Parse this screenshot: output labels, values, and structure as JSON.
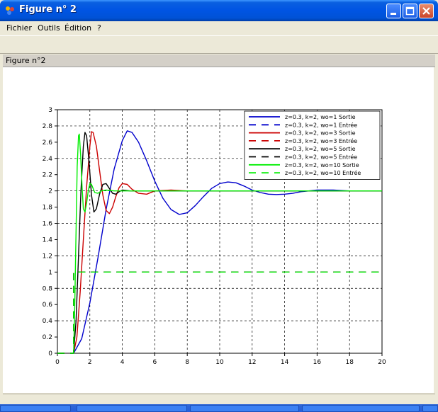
{
  "window": {
    "title": "Figure n° 2"
  },
  "menu": [
    "Fichier",
    "Outils",
    "Édition",
    "?"
  ],
  "figure_label": "Figure n°2",
  "colors": {
    "blue": "#0000cc",
    "red": "#cc0000",
    "black": "#000000",
    "green": "#00ee00"
  },
  "chart_data": {
    "type": "line",
    "title": "",
    "xlabel": "",
    "ylabel": "",
    "xlim": [
      0,
      20
    ],
    "ylim": [
      0,
      3
    ],
    "xticks": [
      0,
      2,
      4,
      6,
      8,
      10,
      12,
      14,
      16,
      18,
      20
    ],
    "yticks": [
      0,
      0.2,
      0.4,
      0.6,
      0.8,
      1,
      1.2,
      1.4,
      1.6,
      1.8,
      2,
      2.2,
      2.4,
      2.6,
      2.8,
      3
    ],
    "grid": true,
    "legend_position": "top-right",
    "series": [
      {
        "name": "z=0.3, k=2, wo=1 Sortie",
        "color": "#0000cc",
        "style": "solid",
        "x": [
          1,
          1.5,
          2,
          2.5,
          3,
          3.5,
          4,
          4.3,
          4.6,
          5,
          5.5,
          6,
          6.5,
          7,
          7.5,
          8,
          8.5,
          9,
          9.5,
          10,
          10.5,
          11,
          11.5,
          12,
          12.5,
          13,
          13.5,
          14,
          14.5,
          15,
          16,
          17,
          18,
          19,
          20
        ],
        "y": [
          0,
          0.18,
          0.62,
          1.18,
          1.77,
          2.27,
          2.62,
          2.74,
          2.72,
          2.6,
          2.37,
          2.12,
          1.91,
          1.77,
          1.71,
          1.73,
          1.82,
          1.93,
          2.03,
          2.09,
          2.11,
          2.1,
          2.06,
          2.01,
          1.98,
          1.96,
          1.955,
          1.96,
          1.97,
          1.99,
          2.01,
          2.01,
          2.0,
          2.0,
          2.0
        ]
      },
      {
        "name": "z=0.3, k=2, wo=1 Entrée",
        "color": "#0000cc",
        "style": "dashed",
        "x": [
          0,
          1,
          1,
          20
        ],
        "y": [
          0,
          0,
          1,
          1
        ]
      },
      {
        "name": "z=0.3, k=2, wo=3 Sortie",
        "color": "#cc0000",
        "style": "solid",
        "x": [
          1,
          1.2,
          1.4,
          1.6,
          1.8,
          2,
          2.1,
          2.2,
          2.4,
          2.6,
          2.8,
          3,
          3.2,
          3.4,
          3.6,
          3.8,
          4,
          4.3,
          4.6,
          5,
          5.5,
          6,
          7,
          8,
          9,
          10,
          20
        ],
        "y": [
          0,
          0.2,
          0.75,
          1.4,
          2.05,
          2.55,
          2.73,
          2.72,
          2.55,
          2.25,
          1.95,
          1.76,
          1.72,
          1.8,
          1.93,
          2.04,
          2.09,
          2.08,
          2.02,
          1.97,
          1.96,
          2.0,
          2.01,
          2.0,
          2.0,
          2.0,
          2.0
        ]
      },
      {
        "name": "z=0.3, k=2, wo=3 Entrée",
        "color": "#cc0000",
        "style": "dashed",
        "x": [
          0,
          1,
          1,
          20
        ],
        "y": [
          0,
          0,
          1,
          1
        ]
      },
      {
        "name": "z=0.3, k=2, wo=5 Sortie",
        "color": "#000000",
        "style": "solid",
        "x": [
          1,
          1.15,
          1.3,
          1.45,
          1.6,
          1.7,
          1.8,
          1.95,
          2.1,
          2.25,
          2.4,
          2.6,
          2.8,
          3,
          3.2,
          3.4,
          3.6,
          3.8,
          4,
          4.5,
          5,
          6,
          8,
          10,
          20
        ],
        "y": [
          0,
          0.4,
          1.2,
          2.0,
          2.55,
          2.72,
          2.68,
          2.35,
          1.95,
          1.74,
          1.78,
          1.96,
          2.08,
          2.09,
          2.03,
          1.97,
          1.96,
          1.99,
          2.01,
          2.0,
          2.0,
          2.0,
          2.0,
          2.0,
          2.0
        ]
      },
      {
        "name": "z=0.3, k=2, wo=5 Entrée",
        "color": "#000000",
        "style": "dashed",
        "x": [
          0,
          1,
          1,
          20
        ],
        "y": [
          0,
          0,
          1,
          1
        ]
      },
      {
        "name": "z=0.3, k=2, wo=10 Sortie",
        "color": "#00ee00",
        "style": "solid",
        "x": [
          1,
          1.07,
          1.15,
          1.22,
          1.3,
          1.35,
          1.43,
          1.52,
          1.6,
          1.7,
          1.8,
          1.9,
          2,
          2.1,
          2.2,
          2.3,
          2.5,
          2.7,
          3,
          3.5,
          4,
          5,
          6,
          10,
          20
        ],
        "y": [
          0,
          0.6,
          1.5,
          2.3,
          2.68,
          2.7,
          2.45,
          2.05,
          1.78,
          1.74,
          1.85,
          2.0,
          2.09,
          2.08,
          2.03,
          1.98,
          1.97,
          2.0,
          2.01,
          2.0,
          2.0,
          2.0,
          2.0,
          2.0,
          2.0
        ]
      },
      {
        "name": "z=0.3, k=2, wo=10 Entrée",
        "color": "#00ee00",
        "style": "dashed",
        "x": [
          0,
          1,
          1,
          20
        ],
        "y": [
          0,
          0,
          1,
          1
        ]
      }
    ]
  }
}
